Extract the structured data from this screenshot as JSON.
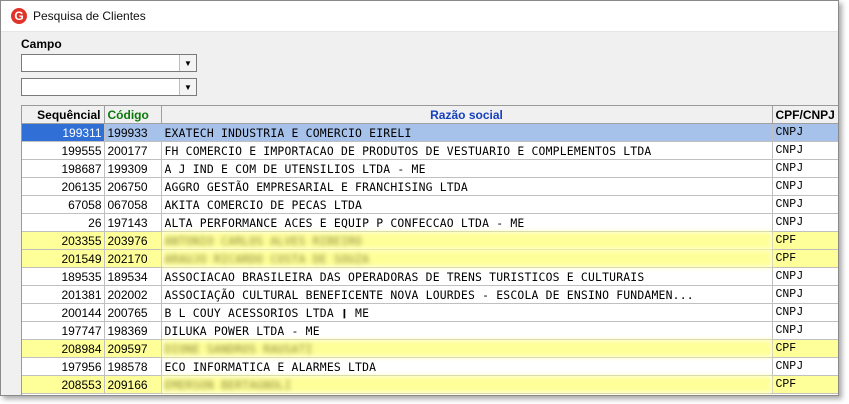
{
  "window": {
    "title": "Pesquisa de Clientes"
  },
  "filters": {
    "field_label": "Campo",
    "combo1_value": "",
    "combo2_value": ""
  },
  "table": {
    "headers": {
      "seq": "Sequêncial",
      "cod": "Código",
      "razao": "Razão social",
      "cpf": "CPF/CNPJ"
    },
    "rows": [
      {
        "seq": "199311",
        "cod": "199933",
        "razao": "  EXATECH INDUSTRIA E COMERCIO EIRELI",
        "cpf": "CNPJ",
        "state": "selected"
      },
      {
        "seq": "199555",
        "cod": "200177",
        "razao": " FH COMERCIO E IMPORTACAO DE PRODUTOS DE VESTUARIO E COMPLEMENTOS LTDA",
        "cpf": "CNPJ",
        "state": ""
      },
      {
        "seq": "198687",
        "cod": "199309",
        "razao": "A J IND E COM DE UTENSILIOS LTDA - ME",
        "cpf": "CNPJ",
        "state": ""
      },
      {
        "seq": "206135",
        "cod": "206750",
        "razao": "AGGRO GESTÃO EMPRESARIAL E FRANCHISING LTDA",
        "cpf": "CNPJ",
        "state": ""
      },
      {
        "seq": "67058",
        "cod": "067058",
        "razao": "AKITA COMERCIO DE PECAS LTDA",
        "cpf": "CNPJ",
        "state": ""
      },
      {
        "seq": "26",
        "cod": "197143",
        "razao": "ALTA PERFORMANCE ACES E EQUIP P CONFECCAO LTDA - ME",
        "cpf": "CNPJ",
        "state": ""
      },
      {
        "seq": "203355",
        "cod": "203976",
        "razao": "ANTONIO CARLOS ALVES RIBEIRO",
        "cpf": "CPF",
        "state": "yellow",
        "blurred": true
      },
      {
        "seq": "201549",
        "cod": "202170",
        "razao": "ARAUJO RICARDO COSTA DE SOUZA",
        "cpf": "CPF",
        "state": "yellow",
        "blurred": true
      },
      {
        "seq": "189535",
        "cod": "189534",
        "razao": "ASSOCIACAO BRASILEIRA DAS OPERADORAS DE TRENS TURISTICOS E CULTURAIS",
        "cpf": "CNPJ",
        "state": ""
      },
      {
        "seq": "201381",
        "cod": "202002",
        "razao": "ASSOCIAÇÃO CULTURAL BENEFICENTE NOVA LOURDES - ESCOLA DE ENSINO FUNDAMEN...",
        "cpf": "CNPJ",
        "state": ""
      },
      {
        "seq": "200144",
        "cod": "200765",
        "razao": "B L COUY ACESSORIOS LTDA ❙ ME",
        "cpf": "CNPJ",
        "state": ""
      },
      {
        "seq": "197747",
        "cod": "198369",
        "razao": "DILUKA POWER LTDA - ME",
        "cpf": "CNPJ",
        "state": ""
      },
      {
        "seq": "208984",
        "cod": "209597",
        "razao": "DIONE SANDROS RAUSATI",
        "cpf": "CPF",
        "state": "yellow",
        "blurred": true
      },
      {
        "seq": "197956",
        "cod": "198578",
        "razao": "ECO INFORMATICA E ALARMES LTDA",
        "cpf": "CNPJ",
        "state": ""
      },
      {
        "seq": "208553",
        "cod": "209166",
        "razao": "EMERSON BERTAGNOLI",
        "cpf": "CPF",
        "state": "yellow",
        "blurred": true
      }
    ]
  }
}
